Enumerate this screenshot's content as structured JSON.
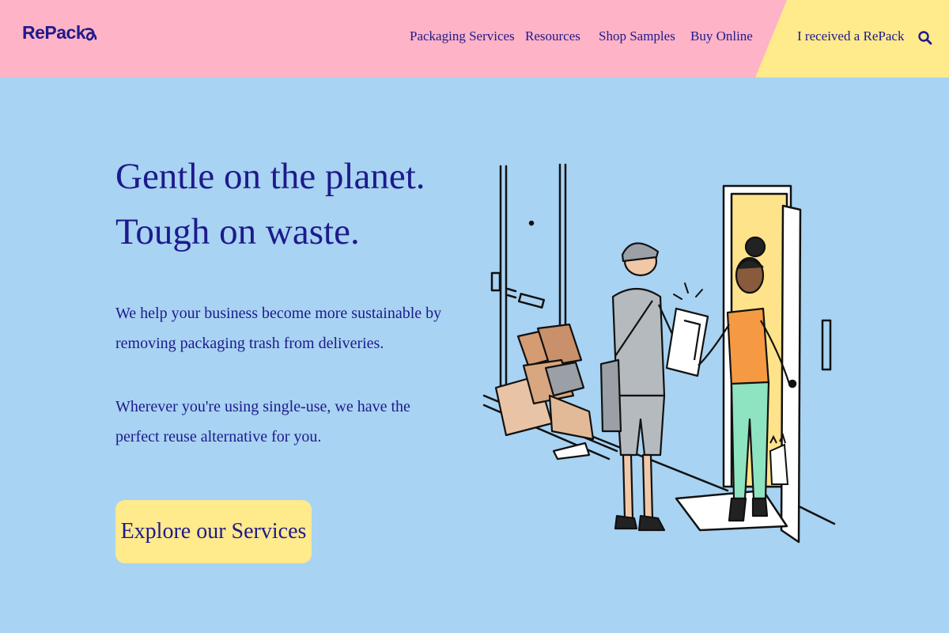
{
  "brand": {
    "name": "RePack"
  },
  "nav": {
    "items": [
      {
        "label": "Packaging Services"
      },
      {
        "label": "Resources"
      },
      {
        "label": "Shop Samples"
      },
      {
        "label": "Buy Online"
      }
    ],
    "received_label": "I received a RePack",
    "search_icon": "search-icon"
  },
  "hero": {
    "title_line1": "Gentle on the planet.",
    "title_line2": "Tough on waste.",
    "paragraph1": "We help your business become more sustainable by removing packaging trash from deliveries.",
    "paragraph2": "Wherever you're using single-use, we have the perfect reuse alternative for you.",
    "cta_label": "Explore our Services"
  },
  "colors": {
    "header_pink": "#ffb3c6",
    "header_yellow": "#ffea8c",
    "background_blue": "#a8d3f2",
    "text_navy": "#1e1a8c",
    "cta_yellow": "#ffea8c"
  }
}
